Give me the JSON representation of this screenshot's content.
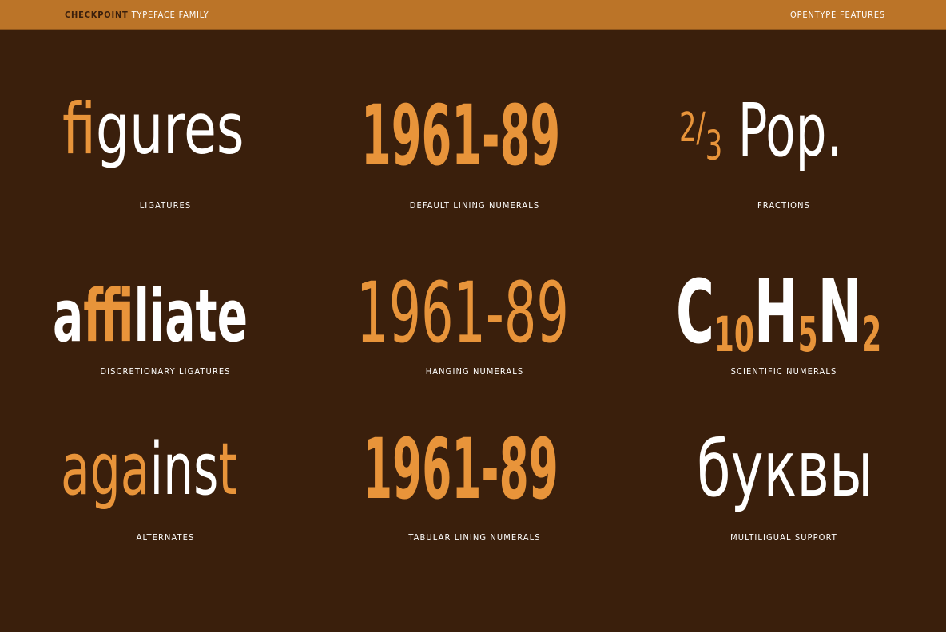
{
  "header": {
    "brand": "CHECKPOINT",
    "family": "TYPEFACE FAMILY",
    "right": "OPENTYPE FEATURES"
  },
  "samples": {
    "ligatures": {
      "part1": "fi",
      "part2": "gures",
      "caption": "LIGATURES"
    },
    "default_lining": {
      "text": "1961-89",
      "caption": "DEFAULT LINING NUMERALS"
    },
    "fractions": {
      "numerator": "2",
      "slash": "/",
      "denominator": "3",
      "word": "Pop.",
      "caption": "FRACTIONS"
    },
    "discretionary": {
      "part1": "a",
      "part2": "ffi",
      "part3": "liate",
      "caption": "DISCRETIONARY LIGATURES"
    },
    "hanging": {
      "text": "1961-89",
      "caption": "HANGING NUMERALS"
    },
    "scientific": {
      "c": "C",
      "c_sub": "10",
      "h": "H",
      "h_sub": "5",
      "n": "N",
      "n_sub": "2",
      "caption": "SCIENTIFIC NUMERALS"
    },
    "alternates": {
      "part1": "aga",
      "part2": "ins",
      "part3": "t",
      "caption": "ALTERNATES"
    },
    "tabular": {
      "text": "1961-89",
      "caption": "TABULAR LINING NUMERALS"
    },
    "multilingual": {
      "text": "буквы",
      "caption": "MULTILIGUAL SUPPORT"
    }
  },
  "colors": {
    "background": "#3a1f0c",
    "header_bar": "#bb7428",
    "accent": "#e8943a",
    "white": "#ffffff"
  }
}
